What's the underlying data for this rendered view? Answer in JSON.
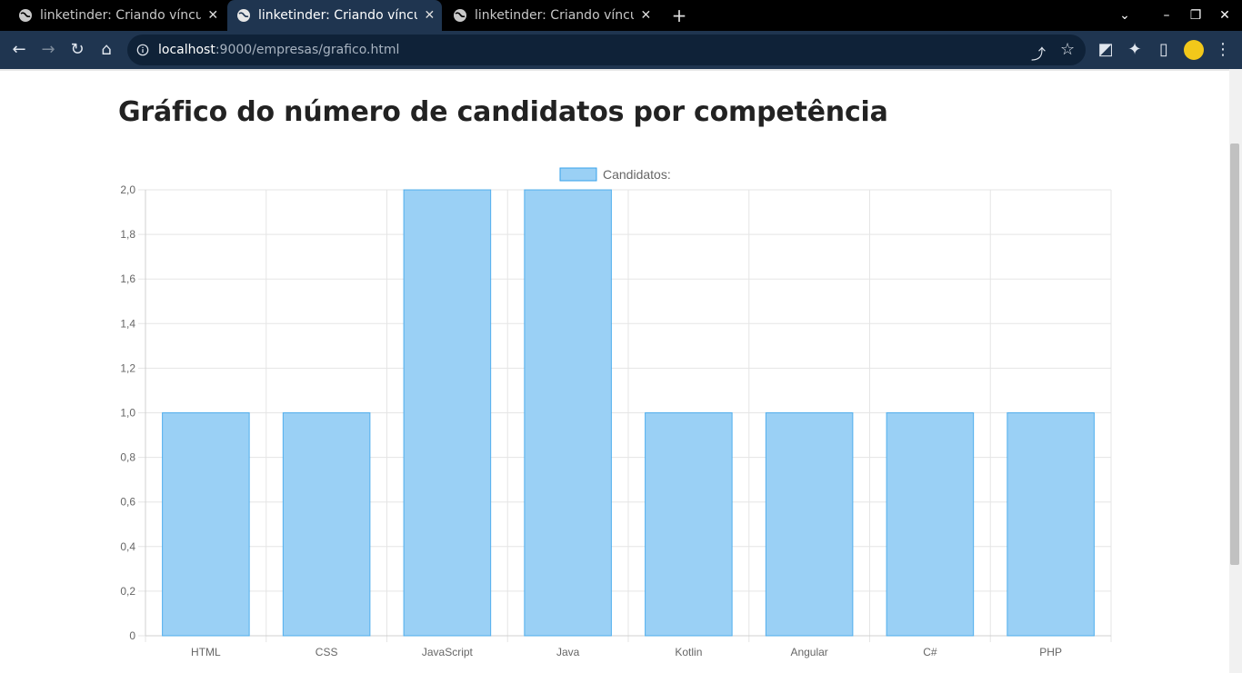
{
  "browser": {
    "tabs": [
      {
        "title": "linketinder: Criando víncu",
        "active": false
      },
      {
        "title": "linketinder: Criando víncu",
        "active": true
      },
      {
        "title": "linketinder: Criando víncu",
        "active": false
      }
    ],
    "url_host": "localhost",
    "url_rest": ":9000/empresas/grafico.html"
  },
  "page": {
    "title": "Gráfico do número de candidatos por competência"
  },
  "chart_data": {
    "type": "bar",
    "categories": [
      "HTML",
      "CSS",
      "JavaScript",
      "Java",
      "Kotlin",
      "Angular",
      "C#",
      "PHP"
    ],
    "series": [
      {
        "name": "Candidatos:",
        "values": [
          1,
          1,
          2,
          2,
          1,
          1,
          1,
          1
        ],
        "color": "#9ad0f5",
        "border_color": "#36a2eb"
      }
    ],
    "ylim": [
      0,
      2
    ],
    "yticks": [
      "0",
      "0,2",
      "0,4",
      "0,6",
      "0,8",
      "1,0",
      "1,2",
      "1,4",
      "1,6",
      "1,8",
      "2,0"
    ],
    "legend_position": "top",
    "grid": true
  }
}
